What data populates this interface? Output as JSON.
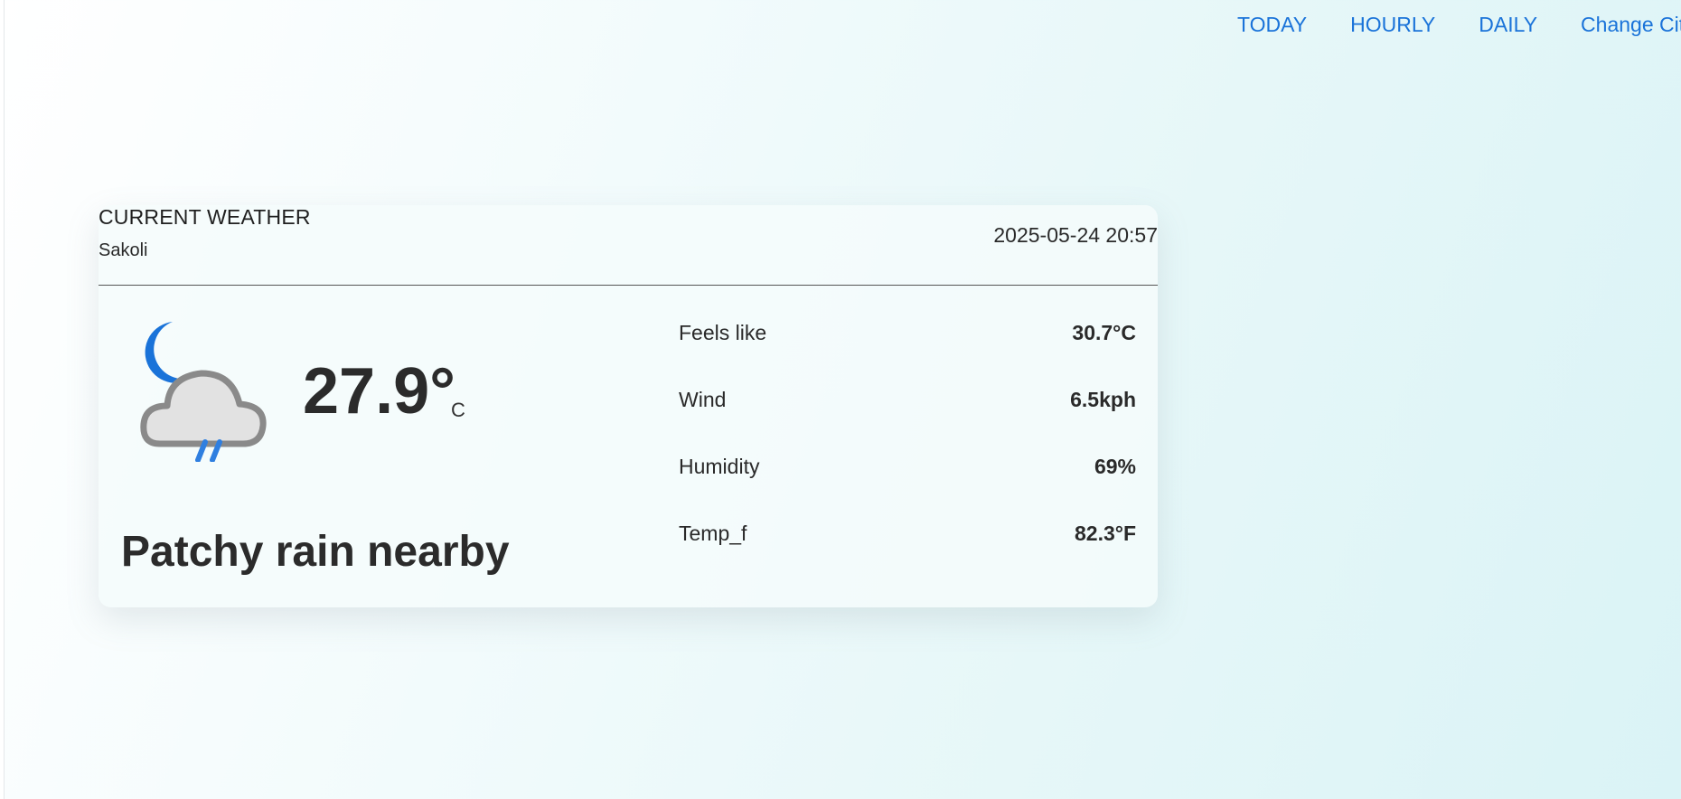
{
  "nav": {
    "items": [
      {
        "label": "TODAY"
      },
      {
        "label": "HOURLY"
      },
      {
        "label": "DAILY"
      },
      {
        "label": "Change City"
      }
    ]
  },
  "current": {
    "title": "CURRENT WEATHER",
    "city": "Sakoli",
    "datetime": "2025-05-24 20:57",
    "temperature": "27.9°",
    "temperature_unit": "C",
    "condition": "Patchy rain nearby",
    "icon": "night-patchy-rain-icon",
    "details": [
      {
        "label": "Feels like",
        "value": "30.7°C"
      },
      {
        "label": "Wind",
        "value": "6.5kph"
      },
      {
        "label": "Humidity",
        "value": "69%"
      },
      {
        "label": "Temp_f",
        "value": "82.3°F"
      }
    ]
  },
  "colors": {
    "accent_link": "#1a73d9",
    "moon": "#1a73d9",
    "cloud_fill": "#e2e2e2",
    "cloud_stroke": "#8a8a8a",
    "rain": "#2f7fe0"
  }
}
